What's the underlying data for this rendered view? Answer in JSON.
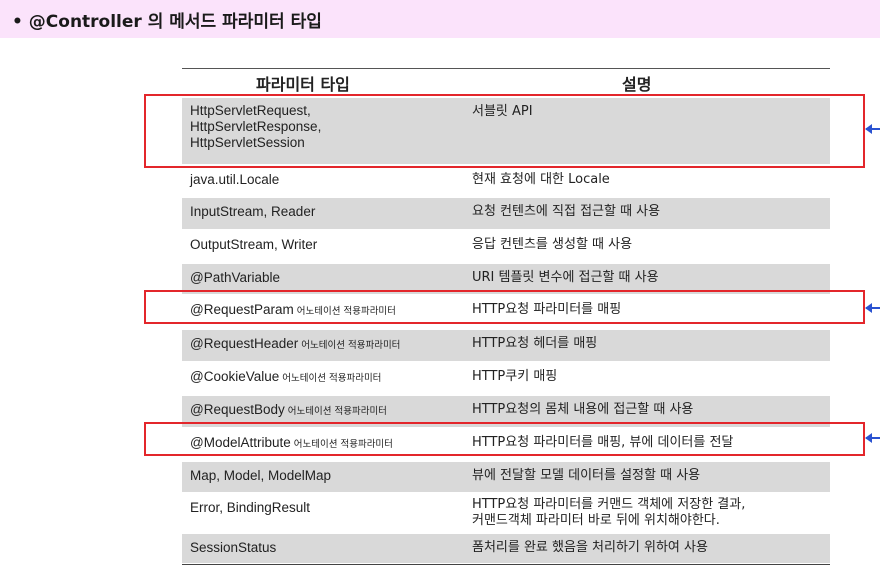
{
  "title": "• @Controller 의 메서드 파라미터 타입",
  "table": {
    "headers": [
      "파라미터 타입",
      "설명"
    ],
    "annotation_suffix": "어노테이션 적용파라미터",
    "rows": [
      {
        "type": "HttpServletRequest,\nHttpServletResponse,\nHttpServletSession",
        "desc": "서블릿 API",
        "annotated": false
      },
      {
        "type": "java.util.Locale",
        "desc": "현재 효청에 대한 Locale",
        "annotated": false
      },
      {
        "type": "InputStream, Reader",
        "desc": "요청 컨텐츠에 직접 접근할 때 사용",
        "annotated": false
      },
      {
        "type": "OutputStream, Writer",
        "desc": "응답 컨텐츠를 생성할 때 사용",
        "annotated": false
      },
      {
        "type": "@PathVariable",
        "desc": "URI 템플릿 변수에 접근할 때 사용",
        "annotated": false
      },
      {
        "type": "@RequestParam",
        "desc": "HTTP요청 파라미터를 매핑",
        "annotated": true
      },
      {
        "type": "@RequestHeader",
        "desc": "HTTP요청 헤더를 매핑",
        "annotated": true
      },
      {
        "type": "@CookieValue",
        "desc": "HTTP쿠키 매핑",
        "annotated": true
      },
      {
        "type": "@RequestBody",
        "desc": "HTTP요청의 몸체 내용에 접근할 때 사용",
        "annotated": true
      },
      {
        "type": "@ModelAttribute",
        "desc": "HTTP요청 파라미터를 매핑, 뷰에 데이터를 전달",
        "annotated": true
      },
      {
        "type": "Map, Model, ModelMap",
        "desc": "뷰에 전달할 모델 데이터를 설정할 때 사용",
        "annotated": false
      },
      {
        "type": "Error, BindingResult",
        "desc": "HTTP요청 파라미터를 커맨드 객체에 저장한 결과,\n커맨드객체 파라미터 바로 뒤에 위치해야한다.",
        "annotated": false
      },
      {
        "type": "SessionStatus",
        "desc": "폼처리를 완료 했음을 처리하기 위하여 사용",
        "annotated": false
      }
    ]
  },
  "colors": {
    "title_bg": "#fbe3fb",
    "row_gray": "#d9d9d9",
    "highlight": "#e3262b",
    "arrow": "#2a52d1"
  }
}
